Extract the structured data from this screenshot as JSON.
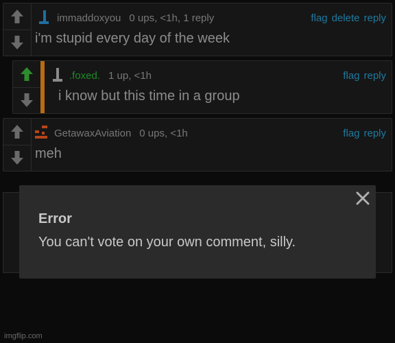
{
  "comments": [
    {
      "username": "immaddoxyou",
      "meta": "0 ups, <1h, 1 reply",
      "actions": {
        "flag": "flag",
        "delete": "delete",
        "reply": "reply"
      },
      "text": "i'm stupid every day of the week"
    },
    {
      "username": ".foxed.",
      "meta": "1 up, <1h",
      "actions": {
        "flag": "flag",
        "reply": "reply"
      },
      "text": "i know but this time in a group",
      "upvoted": true
    },
    {
      "username": "GetawaxAviation",
      "meta": "0 ups, <1h",
      "actions": {
        "flag": "flag",
        "reply": "reply"
      },
      "text": "meh"
    }
  ],
  "dialog": {
    "title": "Error",
    "message": "You can't vote on your own comment, silly."
  },
  "watermark": "imgflip.com",
  "colors": {
    "link": "#1d7aa0",
    "upvote_active": "#2e8b2e",
    "reply_accent": "#b86a14",
    "username_green": "#1f8a2a"
  },
  "icons": {
    "upvote": "up-arrow-icon",
    "downvote": "down-arrow-icon",
    "close": "close-icon"
  }
}
